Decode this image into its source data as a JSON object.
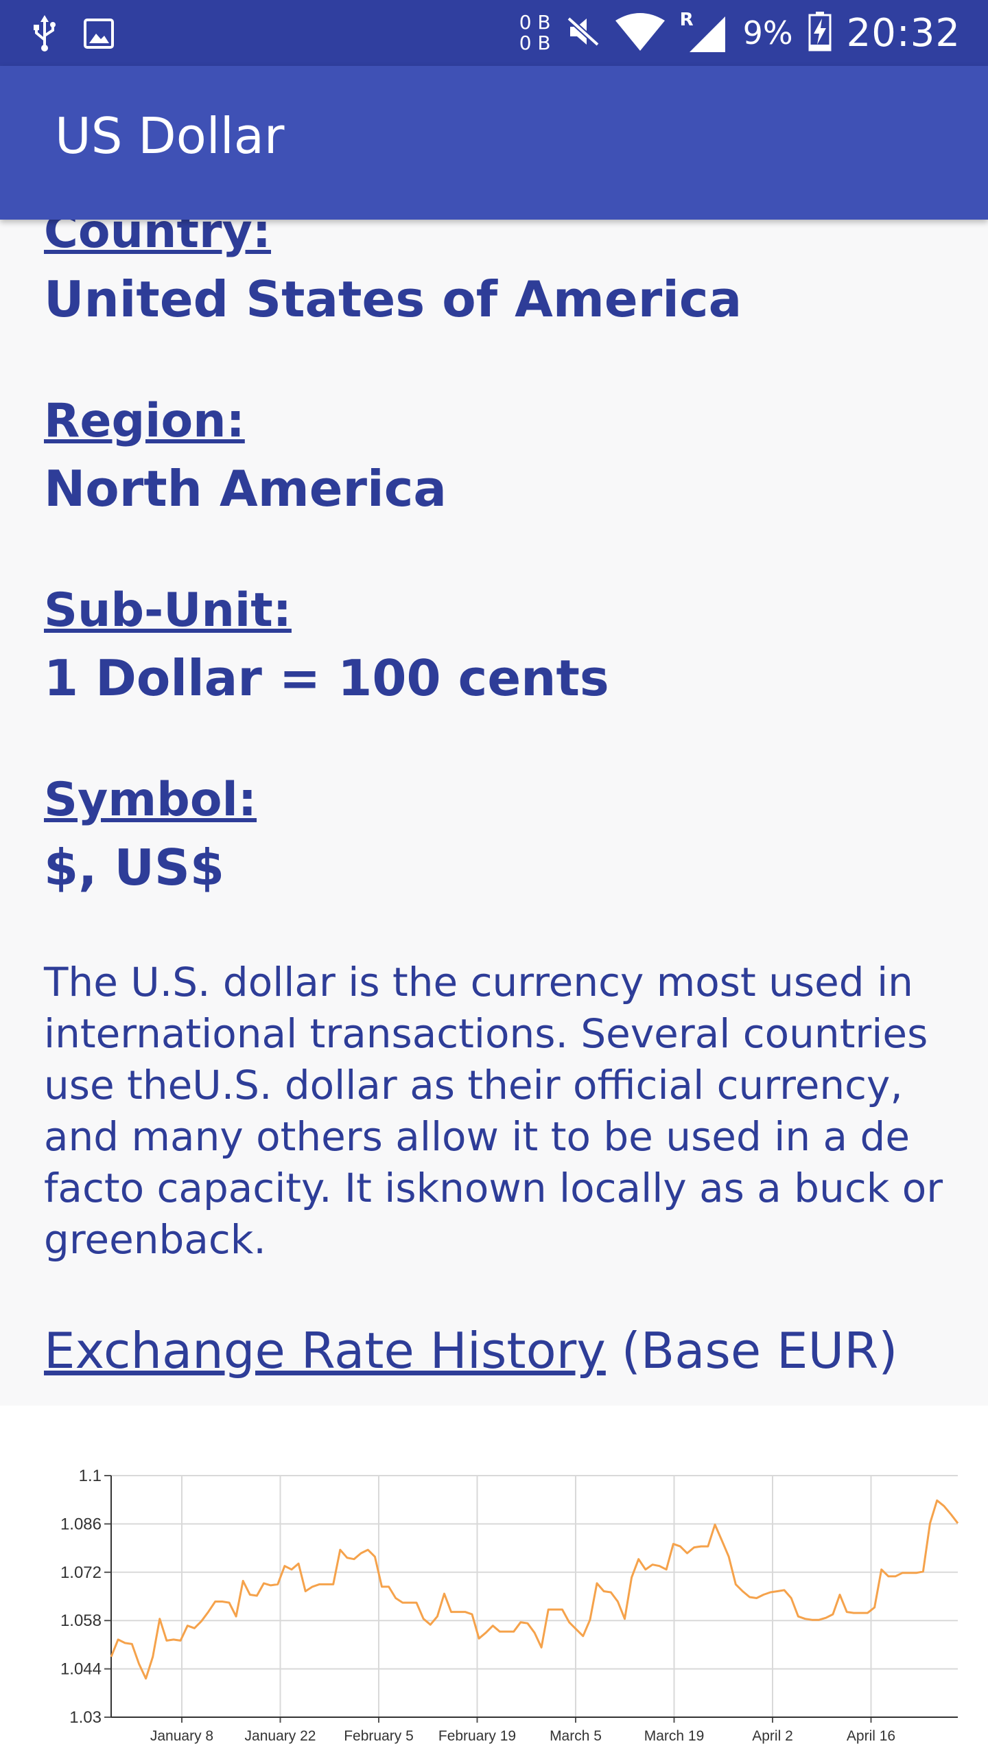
{
  "status_bar": {
    "data_up": "0 B",
    "data_down": "0 B",
    "network_label": "R",
    "battery": "9%",
    "time": "20:32",
    "icons": [
      "usb-icon",
      "image-icon",
      "mute-icon",
      "wifi-icon",
      "signal-icon",
      "battery-charging-icon"
    ]
  },
  "app_bar": {
    "title": "US Dollar"
  },
  "details": {
    "country_label": "Country:",
    "country_value": "United States of America",
    "region_label": "Region:",
    "region_value": "North America",
    "subunit_label": "Sub-Unit:",
    "subunit_value": "1 Dollar = 100 cents",
    "symbol_label": "Symbol:",
    "symbol_value": "$, US$",
    "description": "The U.S. dollar is the currency most used in international transactions. Several countries use theU.S. dollar as their official currency, and many others allow it to be used in a de facto capacity. It isknown locally as a buck or greenback."
  },
  "history": {
    "heading_link": "Exchange Rate History",
    "heading_suffix": " (Base EUR)"
  },
  "colors": {
    "status_bar": "#303f9f",
    "app_bar": "#3f51b5",
    "text": "#2e3d98",
    "line": "#f5a24b",
    "grid": "#d9d9d9"
  },
  "chart_data": {
    "type": "line",
    "title": "",
    "xlabel": "",
    "ylabel": "",
    "ylim": [
      1.03,
      1.1
    ],
    "yticks": [
      1.1,
      1.086,
      1.072,
      1.058,
      1.044,
      1.03
    ],
    "ytick_labels": [
      "1.1",
      "1.086",
      "1.072",
      "1.058",
      "1.044",
      "1.03"
    ],
    "xtick_labels": [
      "January 8",
      "January 22",
      "February 5",
      "February 19",
      "March 5",
      "March 19",
      "April 2",
      "April 16"
    ],
    "grid": true,
    "legend": "none",
    "series": [
      {
        "values": [
          1.0475,
          1.0525,
          1.0515,
          1.0512,
          1.0455,
          1.0412,
          1.0475,
          1.0585,
          1.0522,
          1.0525,
          1.0522,
          1.0565,
          1.0558,
          1.0578,
          1.0605,
          1.0635,
          1.0635,
          1.0632,
          1.0592,
          1.0695,
          1.0655,
          1.0652,
          1.0688,
          1.0682,
          1.0685,
          1.0738,
          1.0728,
          1.0745,
          1.0665,
          1.0678,
          1.0685,
          1.0685,
          1.0685,
          1.0785,
          1.0762,
          1.0758,
          1.0775,
          1.0785,
          1.0765,
          1.0678,
          1.0678,
          1.0645,
          1.0632,
          1.0632,
          1.0632,
          1.0585,
          1.0568,
          1.0592,
          1.0658,
          1.0605,
          1.0605,
          1.0605,
          1.0598,
          1.0528,
          1.0545,
          1.0565,
          1.0548,
          1.0548,
          1.0548,
          1.0575,
          1.0572,
          1.0545,
          1.0502,
          1.0612,
          1.0612,
          1.0612,
          1.0575,
          1.0555,
          1.0535,
          1.0582,
          1.0688,
          1.0665,
          1.0662,
          1.0635,
          1.0585,
          1.0705,
          1.0758,
          1.0728,
          1.0742,
          1.0738,
          1.0728,
          1.0802,
          1.0795,
          1.0775,
          1.0792,
          1.0795,
          1.0795,
          1.0858,
          1.0812,
          1.0765,
          1.0685,
          1.0665,
          1.0648,
          1.0645,
          1.0655,
          1.0662,
          1.0665,
          1.0668,
          1.0645,
          1.0592,
          1.0585,
          1.0582,
          1.0582,
          1.0588,
          1.0598,
          1.0655,
          1.0605,
          1.0602,
          1.0602,
          1.0602,
          1.0618,
          1.0728,
          1.0708,
          1.0708,
          1.0718,
          1.0718,
          1.0718,
          1.0722,
          1.0862,
          1.0928,
          1.0912,
          1.0888,
          1.0862
        ]
      }
    ]
  }
}
